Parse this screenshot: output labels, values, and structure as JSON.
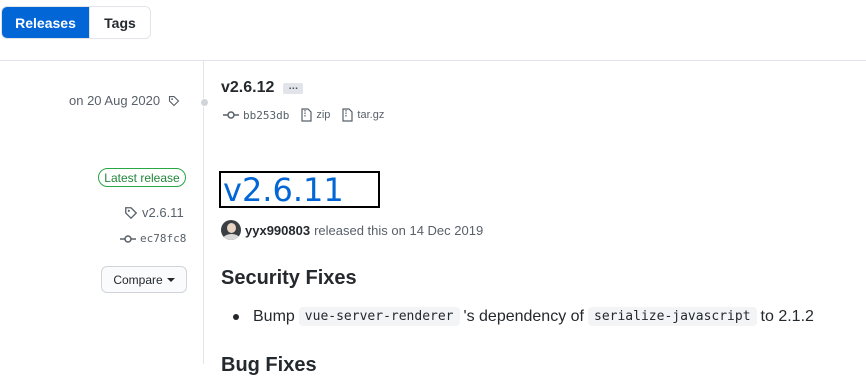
{
  "tabs": {
    "releases": "Releases",
    "tags": "Tags"
  },
  "older_release": {
    "date": "on 20 Aug 2020",
    "version": "v2.6.12",
    "ellipsis": "…",
    "commit": "bb253db",
    "zip": "zip",
    "targz": "tar.gz"
  },
  "latest_release": {
    "badge": "Latest release",
    "tag": "v2.6.11",
    "commit": "ec78fc8",
    "compare_label": "Compare",
    "title": "v2.6.11",
    "author": "yyx990803",
    "released_text": "released this on 14 Dec 2019",
    "section_heading": "Security Fixes",
    "bullet": {
      "prefix": "Bump",
      "code1": "vue-server-renderer",
      "middle": "'s dependency of",
      "code2": "serialize-javascript",
      "suffix": "to 2.1.2"
    },
    "next_heading": "Bug Fixes"
  },
  "colors": {
    "accent": "#0366d6",
    "badge_green": "#28a745",
    "text_muted": "#586069"
  }
}
